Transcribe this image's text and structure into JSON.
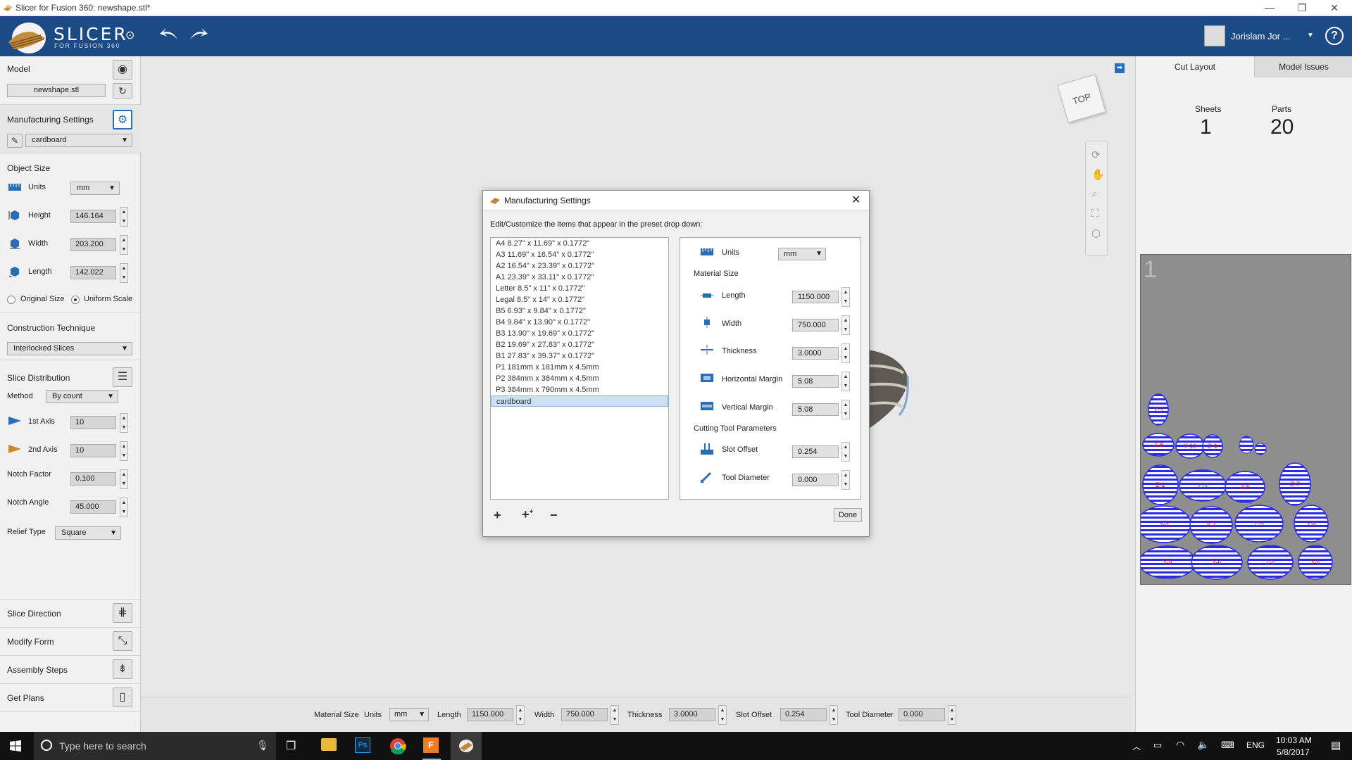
{
  "window": {
    "title": "Slicer for Fusion 360: newshape.stl*",
    "minimize": "—",
    "maximize": "❐",
    "close": "✕"
  },
  "header": {
    "brand": "SLICER",
    "subtitle": "FOR FUSION 360",
    "user_name": "Jorislam Jor ...",
    "help": "?"
  },
  "left": {
    "model_label": "Model",
    "model_file": "newshape.stl",
    "manufacturing_label": "Manufacturing Settings",
    "manufacturing_preset": "cardboard",
    "object_size_label": "Object Size",
    "units_label": "Units",
    "units_value": "mm",
    "height_label": "Height",
    "height_value": "146.164",
    "width_label": "Width",
    "width_value": "203.200",
    "length_label": "Length",
    "length_value": "142.022",
    "original_size": "Original Size",
    "uniform_scale": "Uniform Scale",
    "construction_label": "Construction Technique",
    "construction_value": "Interlocked Slices",
    "slice_distribution_label": "Slice Distribution",
    "method_label": "Method",
    "method_value": "By count",
    "axis1_label": "1st Axis",
    "axis1_value": "10",
    "axis2_label": "2nd Axis",
    "axis2_value": "10",
    "notch_factor_label": "Notch Factor",
    "notch_factor_value": "0.100",
    "notch_angle_label": "Notch Angle",
    "notch_angle_value": "45.000",
    "relief_label": "Relief Type",
    "relief_value": "Square",
    "slice_direction": "Slice Direction",
    "modify_form": "Modify Form",
    "assembly_steps": "Assembly Steps",
    "get_plans": "Get Plans"
  },
  "viewport": {
    "viewcube_label": "TOP"
  },
  "bottombar": {
    "material_size": "Material Size",
    "units_label": "Units",
    "units_value": "mm",
    "length_label": "Length",
    "length_value": "1150.000",
    "width_label": "Width",
    "width_value": "750.000",
    "thickness_label": "Thickness",
    "thickness_value": "3.0000",
    "slot_offset_label": "Slot Offset",
    "slot_offset_value": "0.254",
    "tool_diameter_label": "Tool Diameter",
    "tool_diameter_value": "0.000"
  },
  "right": {
    "tab_cut_layout": "Cut Layout",
    "tab_model_issues": "Model Issues",
    "sheets_label": "Sheets",
    "sheets_value": "1",
    "parts_label": "Parts",
    "parts_value": "20",
    "sheet_number": "1",
    "part_labels": [
      "Y-3",
      "Z-8",
      "Y-10",
      "Z-1",
      "Z-2",
      "Z-3",
      "Z-6",
      "Z-7",
      "Y-4",
      "Y-7",
      "Z-5",
      "Y-8",
      "Y-9",
      "Y-6",
      "Z-4",
      "Y-5",
      "Z-2"
    ]
  },
  "dialog": {
    "title": "Manufacturing Settings",
    "instruction": "Edit/Customize the items that appear in the preset drop down:",
    "presets": [
      "A4 8.27\" x 11.69\" x 0.1772\"",
      "A3 11.69\" x 16.54\" x 0.1772\"",
      "A2 16.54\" x 23.39\" x 0.1772\"",
      "A1 23.39\" x 33.11\" x 0.1772\"",
      "Letter 8.5\" x 11\" x 0.1772\"",
      "Legal 8.5\" x 14\" x 0.1772\"",
      "B5 6.93\" x 9.84\" x 0.1772\"",
      "B4 9.84\" x 13.90\" x 0.1772\"",
      "B3 13.90\" x 19.69\" x 0.1772\"",
      "B2 19.69\" x 27.83\" x 0.1772\"",
      "B1 27.83\" x 39.37\" x 0.1772\"",
      "P1 181mm x 181mm x 4.5mm",
      "P2 384mm x 384mm x 4.5mm",
      "P3 384mm x 790mm x 4.5mm",
      "cardboard"
    ],
    "units_label": "Units",
    "units_value": "mm",
    "material_size": "Material Size",
    "length_label": "Length",
    "length_value": "1150.000",
    "width_label": "Width",
    "width_value": "750.000",
    "thickness_label": "Thickness",
    "thickness_value": "3.0000",
    "hmargin_label": "Horizontal Margin",
    "hmargin_value": "5.08",
    "vmargin_label": "Vertical Margin",
    "vmargin_value": "5.08",
    "cutting_tool": "Cutting Tool Parameters",
    "slot_offset_label": "Slot Offset",
    "slot_offset_value": "0.254",
    "tool_diameter_label": "Tool Diameter",
    "tool_diameter_value": "0.000",
    "add": "+",
    "remove": "−",
    "done": "Done"
  },
  "taskbar": {
    "search_placeholder": "Type here to search",
    "lang": "ENG",
    "time": "10:03 AM",
    "date": "5/8/2017"
  },
  "colors": {
    "header": "#1b4a84",
    "accent": "#2a6db5",
    "selection": "#cce0f5",
    "part_fill": "#2b2be0",
    "taskbar": "#111111"
  }
}
